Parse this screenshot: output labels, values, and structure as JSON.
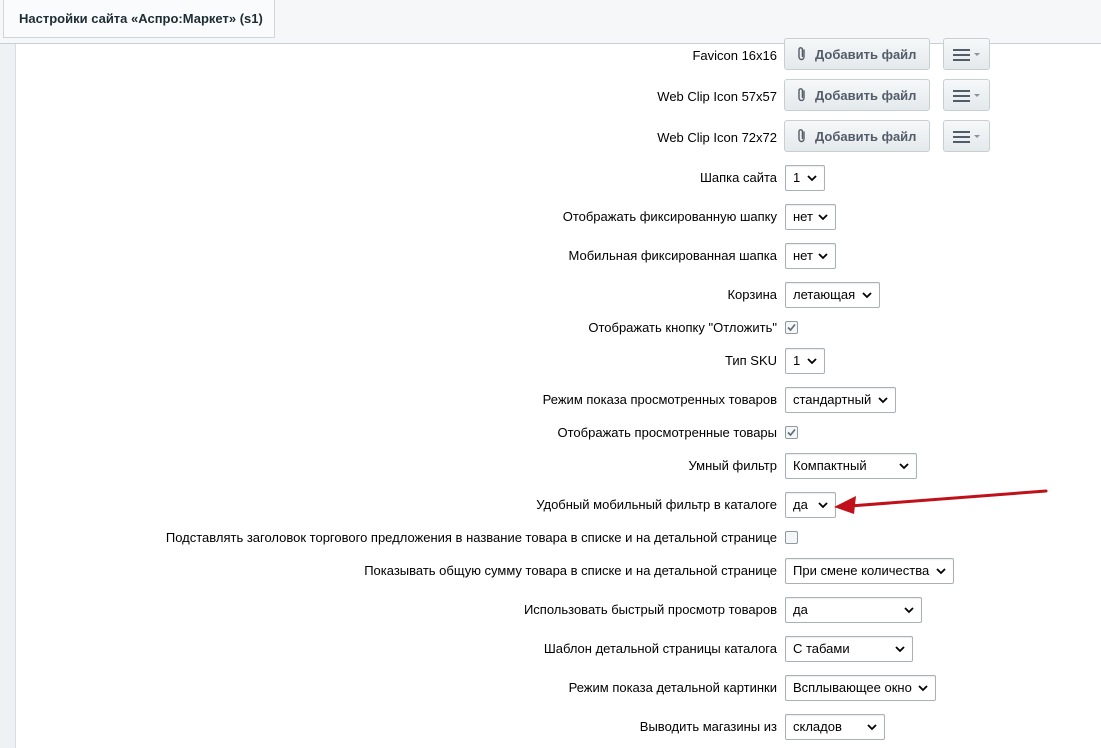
{
  "tab": {
    "title": "Настройки сайта «Аспро:Маркет» (s1)"
  },
  "file_rows": [
    {
      "label": "Favicon 16x16",
      "button": "Добавить файл"
    },
    {
      "label": "Web Clip Icon 57x57",
      "button": "Добавить файл"
    },
    {
      "label": "Web Clip Icon 72x72",
      "button": "Добавить файл"
    }
  ],
  "settings": {
    "site_header": {
      "label": "Шапка сайта",
      "value": "1"
    },
    "fixed_header": {
      "label": "Отображать фиксированную шапку",
      "value": "нет"
    },
    "mobile_fixed_header": {
      "label": "Мобильная фиксированная шапка",
      "value": "нет"
    },
    "basket": {
      "label": "Корзина",
      "value": "летающая"
    },
    "show_delay_button": {
      "label": "Отображать кнопку \"Отложить\"",
      "checked": true
    },
    "sku_type": {
      "label": "Тип SKU",
      "value": "1"
    },
    "viewed_mode": {
      "label": "Режим показа просмотренных товаров",
      "value": "стандартный"
    },
    "show_viewed": {
      "label": "Отображать просмотренные товары",
      "checked": true
    },
    "smart_filter": {
      "label": "Умный фильтр",
      "value": "Компактный"
    },
    "mobile_filter": {
      "label": "Удобный мобильный фильтр в каталоге",
      "value": "да"
    },
    "offer_title": {
      "label": "Подставлять заголовок торгового предложения в название товара в списке и на детальной странице",
      "checked": false
    },
    "total_sum": {
      "label": "Показывать общую сумму товара в списке и на детальной странице",
      "value": "При смене количества"
    },
    "quick_view": {
      "label": "Использовать быстрый просмотр товаров",
      "value": "да"
    },
    "detail_template": {
      "label": "Шаблон детальной страницы каталога",
      "value": "С табами"
    },
    "detail_picture_mode": {
      "label": "Режим показа детальной картинки",
      "value": "Всплывающее окно"
    },
    "stores_from": {
      "label": "Выводить магазины из",
      "value": "складов"
    }
  },
  "colors": {
    "annotation_arrow": "#c0101a",
    "accent_text": "#535c69"
  },
  "icons": {
    "file_button": "paperclip-icon",
    "menu_button": "hamburger-menu-icon",
    "select": "chevron-down-icon"
  }
}
